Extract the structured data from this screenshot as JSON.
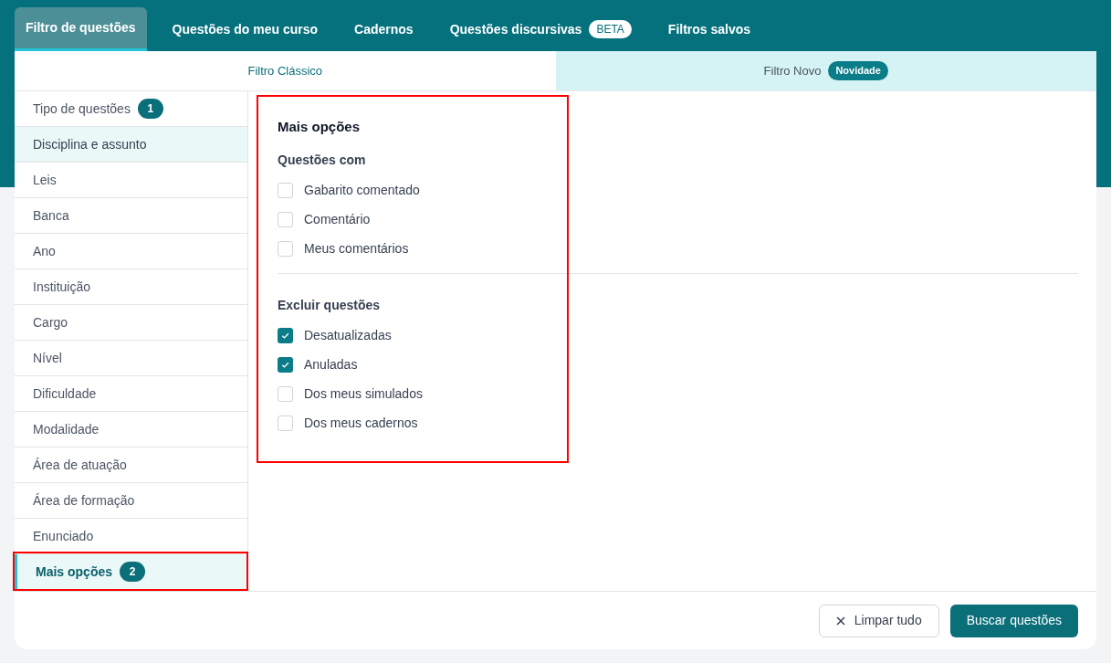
{
  "nav_tabs": [
    {
      "label": "Filtro de questões",
      "selected": true
    },
    {
      "label": "Questões do meu curso",
      "selected": false
    },
    {
      "label": "Cadernos",
      "selected": false
    },
    {
      "label": "Questões discursivas",
      "badge": "BETA",
      "selected": false
    },
    {
      "label": "Filtros salvos",
      "selected": false
    }
  ],
  "filter_modes": [
    {
      "label": "Filtro Clássico",
      "selected": true
    },
    {
      "label": "Filtro Novo",
      "badge": "Novidade",
      "selected": false
    }
  ],
  "sidebar": {
    "items": [
      {
        "label": "Tipo de questões",
        "count": "1",
        "selected": false,
        "hovered": false,
        "highlighted": false
      },
      {
        "label": "Disciplina e assunto",
        "selected": false,
        "hovered": true,
        "highlighted": false
      },
      {
        "label": "Leis",
        "selected": false,
        "hovered": false,
        "highlighted": false
      },
      {
        "label": "Banca",
        "selected": false,
        "hovered": false,
        "highlighted": false
      },
      {
        "label": "Ano",
        "selected": false,
        "hovered": false,
        "highlighted": false
      },
      {
        "label": "Instituição",
        "selected": false,
        "hovered": false,
        "highlighted": false
      },
      {
        "label": "Cargo",
        "selected": false,
        "hovered": false,
        "highlighted": false
      },
      {
        "label": "Nível",
        "selected": false,
        "hovered": false,
        "highlighted": false
      },
      {
        "label": "Dificuldade",
        "selected": false,
        "hovered": false,
        "highlighted": false
      },
      {
        "label": "Modalidade",
        "selected": false,
        "hovered": false,
        "highlighted": false
      },
      {
        "label": "Área de atuação",
        "selected": false,
        "hovered": false,
        "highlighted": false
      },
      {
        "label": "Área de formação",
        "selected": false,
        "hovered": false,
        "highlighted": false
      },
      {
        "label": "Enunciado",
        "selected": false,
        "hovered": false,
        "highlighted": false
      },
      {
        "label": "Mais opções",
        "count": "2",
        "selected": true,
        "hovered": false,
        "highlighted": true
      }
    ]
  },
  "panel": {
    "title": "Mais opções",
    "highlighted": true,
    "groups": [
      {
        "title": "Questões com",
        "options": [
          {
            "label": "Gabarito comentado",
            "checked": false
          },
          {
            "label": "Comentário",
            "checked": false
          },
          {
            "label": "Meus comentários",
            "checked": false
          }
        ]
      },
      {
        "title": "Excluir questões",
        "options": [
          {
            "label": "Desatualizadas",
            "checked": true
          },
          {
            "label": "Anuladas",
            "checked": true
          },
          {
            "label": "Dos meus simulados",
            "checked": false
          },
          {
            "label": "Dos meus cadernos",
            "checked": false
          }
        ]
      }
    ]
  },
  "footer": {
    "clear_button": "Limpar tudo",
    "search_button": "Buscar questões"
  }
}
